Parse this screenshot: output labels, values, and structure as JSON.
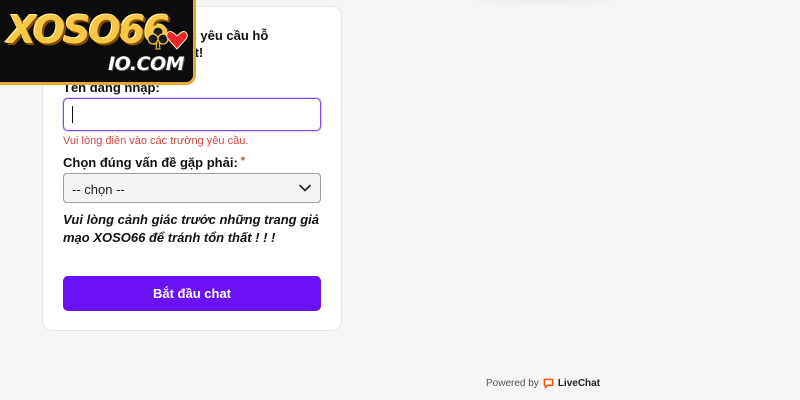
{
  "logo": {
    "main_text": "XOSO66",
    "sub_text": "IO.COM"
  },
  "form": {
    "intro_text": "ính xác yêu cầu hỗ\nnh nhất!",
    "username_label": "Tên đăng nhập:",
    "username_value": "",
    "username_error": "Vui lòng điền vào các trường yêu cầu.",
    "issue_label": "Chọn đúng vấn đề gặp phải:",
    "required_mark": "*",
    "issue_selected": "-- chọn --",
    "warning_text": "Vui lòng cảnh giác trước những trang giả\nmạo XOSO66 để tránh tổn thất ! ! !",
    "submit_label": "Bắt đầu chat"
  },
  "footer": {
    "powered_by": "Powered by",
    "brand": "LiveChat"
  },
  "colors": {
    "accent": "#6b12f5",
    "focus_border": "#7c4de8",
    "error": "#d2463f",
    "logo_gold": "#f6c846",
    "livechat_orange": "#ff5100"
  },
  "icons": {
    "select_arrow": "chevron-down-icon",
    "livechat_logo": "livechat-icon",
    "logo_suits": "club-heart-suits-icon"
  }
}
